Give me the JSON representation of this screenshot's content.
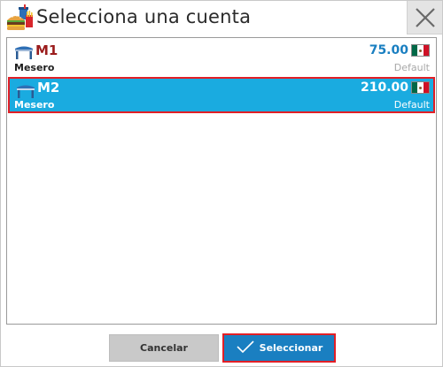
{
  "dialog": {
    "title": "Selecciona una cuenta",
    "app_icon": "restaurant-food-icon",
    "close_icon": "close-icon"
  },
  "accounts": [
    {
      "name": "M1",
      "waiter": "Mesero",
      "amount": "75.00",
      "status": "Default",
      "icon": "table-icon",
      "flag": "mexico-flag-icon",
      "selected": false
    },
    {
      "name": "M2",
      "waiter": "Mesero",
      "amount": "210.00",
      "status": "Default",
      "icon": "table-icon",
      "flag": "mexico-flag-icon",
      "selected": true
    }
  ],
  "buttons": {
    "cancel_label": "Cancelar",
    "select_label": "Seleccionar",
    "select_icon": "checkmark-icon"
  },
  "colors": {
    "selection": "#1aabe0",
    "highlight_border": "#e21f26",
    "primary_button": "#1a7fc1",
    "name_text": "#9b1c1c",
    "amount_text": "#1a7fc1"
  }
}
